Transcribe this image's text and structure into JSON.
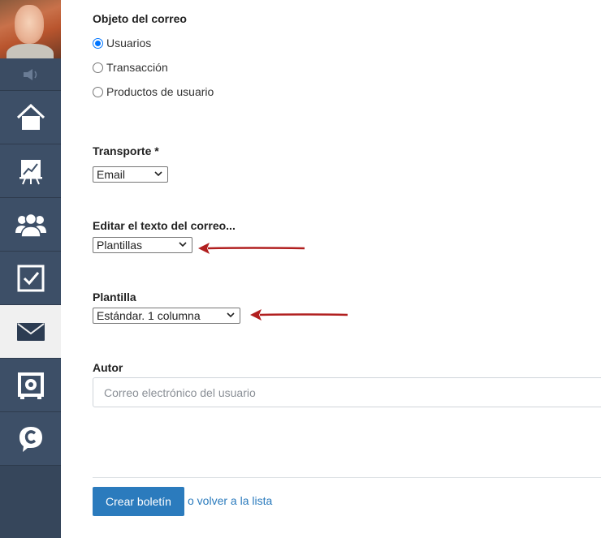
{
  "sidebar": {
    "items": [
      {
        "name": "home",
        "icon": "house-icon",
        "active": false
      },
      {
        "name": "reports",
        "icon": "chart-easel-icon",
        "active": false
      },
      {
        "name": "users",
        "icon": "users-group-icon",
        "active": false
      },
      {
        "name": "tasks",
        "icon": "checkbox-icon",
        "active": false
      },
      {
        "name": "mail",
        "icon": "envelope-icon",
        "active": true
      },
      {
        "name": "safe",
        "icon": "safe-icon",
        "active": false
      },
      {
        "name": "chat",
        "icon": "chat-c-icon",
        "active": false
      }
    ]
  },
  "form": {
    "mail_object": {
      "label": "Objeto del correo",
      "options": [
        "Usuarios",
        "Transacción",
        "Productos de usuario"
      ],
      "selected": "Usuarios"
    },
    "transport": {
      "label": "Transporte *",
      "value": "Email"
    },
    "edit_text": {
      "label": "Editar el texto del correo...",
      "value": "Plantillas"
    },
    "template": {
      "label": "Plantilla",
      "value": "Estándar. 1 columna"
    },
    "author": {
      "label": "Autor",
      "placeholder": "Correo electrónico del usuario"
    }
  },
  "actions": {
    "create_label": "Crear boletín",
    "back_label": "o volver a la lista"
  },
  "colors": {
    "sidebar": "#36465b",
    "primary": "#2b7bbd",
    "annotation_arrow": "#b11f1f"
  }
}
